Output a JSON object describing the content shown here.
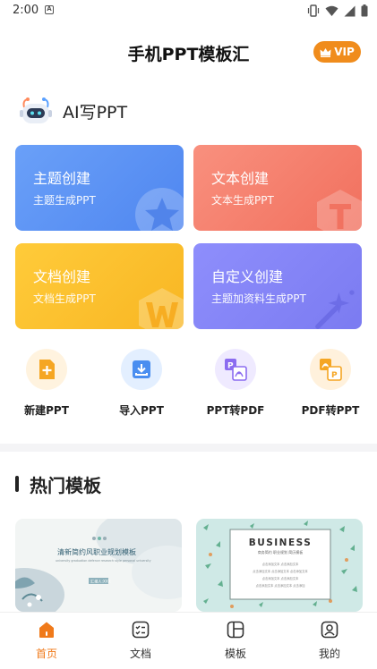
{
  "status_bar": {
    "time": "2:00",
    "notification_letter": "A",
    "icons": [
      "vibrate-icon",
      "wifi-icon",
      "signal-icon",
      "battery-icon"
    ]
  },
  "header": {
    "title": "手机PPT模板汇",
    "vip_label": "VIP"
  },
  "ai": {
    "label": "AI写PPT",
    "icon": "robot-icon"
  },
  "cards": [
    {
      "title": "主题创建",
      "subtitle": "主题生成PPT",
      "color": "#5b92f4",
      "icon": "star-icon"
    },
    {
      "title": "文本创建",
      "subtitle": "文本生成PPT",
      "color": "#f57e6a",
      "icon": "t-letter-icon"
    },
    {
      "title": "文档创建",
      "subtitle": "文档生成PPT",
      "color": "#fbbf2e",
      "icon": "w-letter-icon"
    },
    {
      "title": "自定义创建",
      "subtitle": "主题加资料生成PPT",
      "color": "#8484f6",
      "icon": "magic-wand-icon"
    }
  ],
  "quick_actions": [
    {
      "label": "新建PPT",
      "icon": "new-file-icon",
      "color": "#f5a623"
    },
    {
      "label": "导入PPT",
      "icon": "import-icon",
      "color": "#4a8ef0"
    },
    {
      "label": "PPT转PDF",
      "icon": "ppt-to-pdf-icon",
      "color": "#8b6cf0"
    },
    {
      "label": "PDF转PPT",
      "icon": "pdf-to-ppt-icon",
      "color": "#f5a623"
    }
  ],
  "section": {
    "title": "热门模板"
  },
  "templates": [
    {
      "title": "清新简约风职业规划模板",
      "subtitle": "university graduation defence research style personal university",
      "button": "汇报人:XXX"
    },
    {
      "title": "BUSINESS",
      "subtitle": "商务简约 职业规划 简历模板",
      "lines": [
        "点击添加文本 点击添加文本",
        "点击添加文本 点击添加文本 点击添加文本",
        "点击添加文本 点击添加文本",
        "点击添加文本 点击添加文本 点击添加"
      ]
    }
  ],
  "bottom_nav": [
    {
      "label": "首页",
      "icon": "home-icon",
      "active": true
    },
    {
      "label": "文档",
      "icon": "document-icon",
      "active": false
    },
    {
      "label": "模板",
      "icon": "template-icon",
      "active": false
    },
    {
      "label": "我的",
      "icon": "profile-icon",
      "active": false
    }
  ],
  "accent_color": "#f07a1a"
}
